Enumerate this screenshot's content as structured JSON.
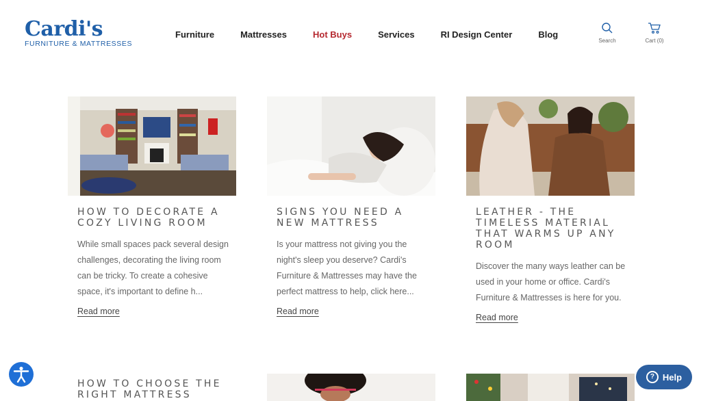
{
  "brand": {
    "name": "Cardi's",
    "tagline": "FURNITURE & MATTRESSES"
  },
  "nav": {
    "items": [
      {
        "label": "Furniture"
      },
      {
        "label": "Mattresses"
      },
      {
        "label": "Hot Buys"
      },
      {
        "label": "Services"
      },
      {
        "label": "RI Design Center"
      },
      {
        "label": "Blog"
      }
    ],
    "accent": "#b5282f"
  },
  "utilities": {
    "search_label": "Search",
    "cart_label": "Cart (0)"
  },
  "posts": [
    {
      "title": "HOW TO DECORATE A COZY LIVING ROOM",
      "excerpt": "While small spaces pack several design challenges, decorating the living room can be tricky. To create a cohesive space, it's important to define h...",
      "link": "Read more"
    },
    {
      "title": "SIGNS YOU NEED A NEW MATTRESS",
      "excerpt": "Is your mattress not giving you the night's sleep you deserve? Cardi's Furniture & Mattresses may have the perfect mattress to help, click here...",
      "link": "Read more"
    },
    {
      "title": "LEATHER - THE TIMELESS MATERIAL THAT WARMS UP ANY ROOM",
      "excerpt": "Discover the many ways leather can be used in your home or office. Cardi's Furniture & Mattresses is here for you.",
      "link": "Read more"
    }
  ],
  "posts_row2": {
    "first_title": "HOW TO CHOOSE THE RIGHT MATTRESS"
  },
  "widgets": {
    "help_label": "Help"
  },
  "colors": {
    "brand_blue": "#1f5fa8",
    "help_blue": "#2c5fa0",
    "access_blue": "#1f6fd6"
  }
}
